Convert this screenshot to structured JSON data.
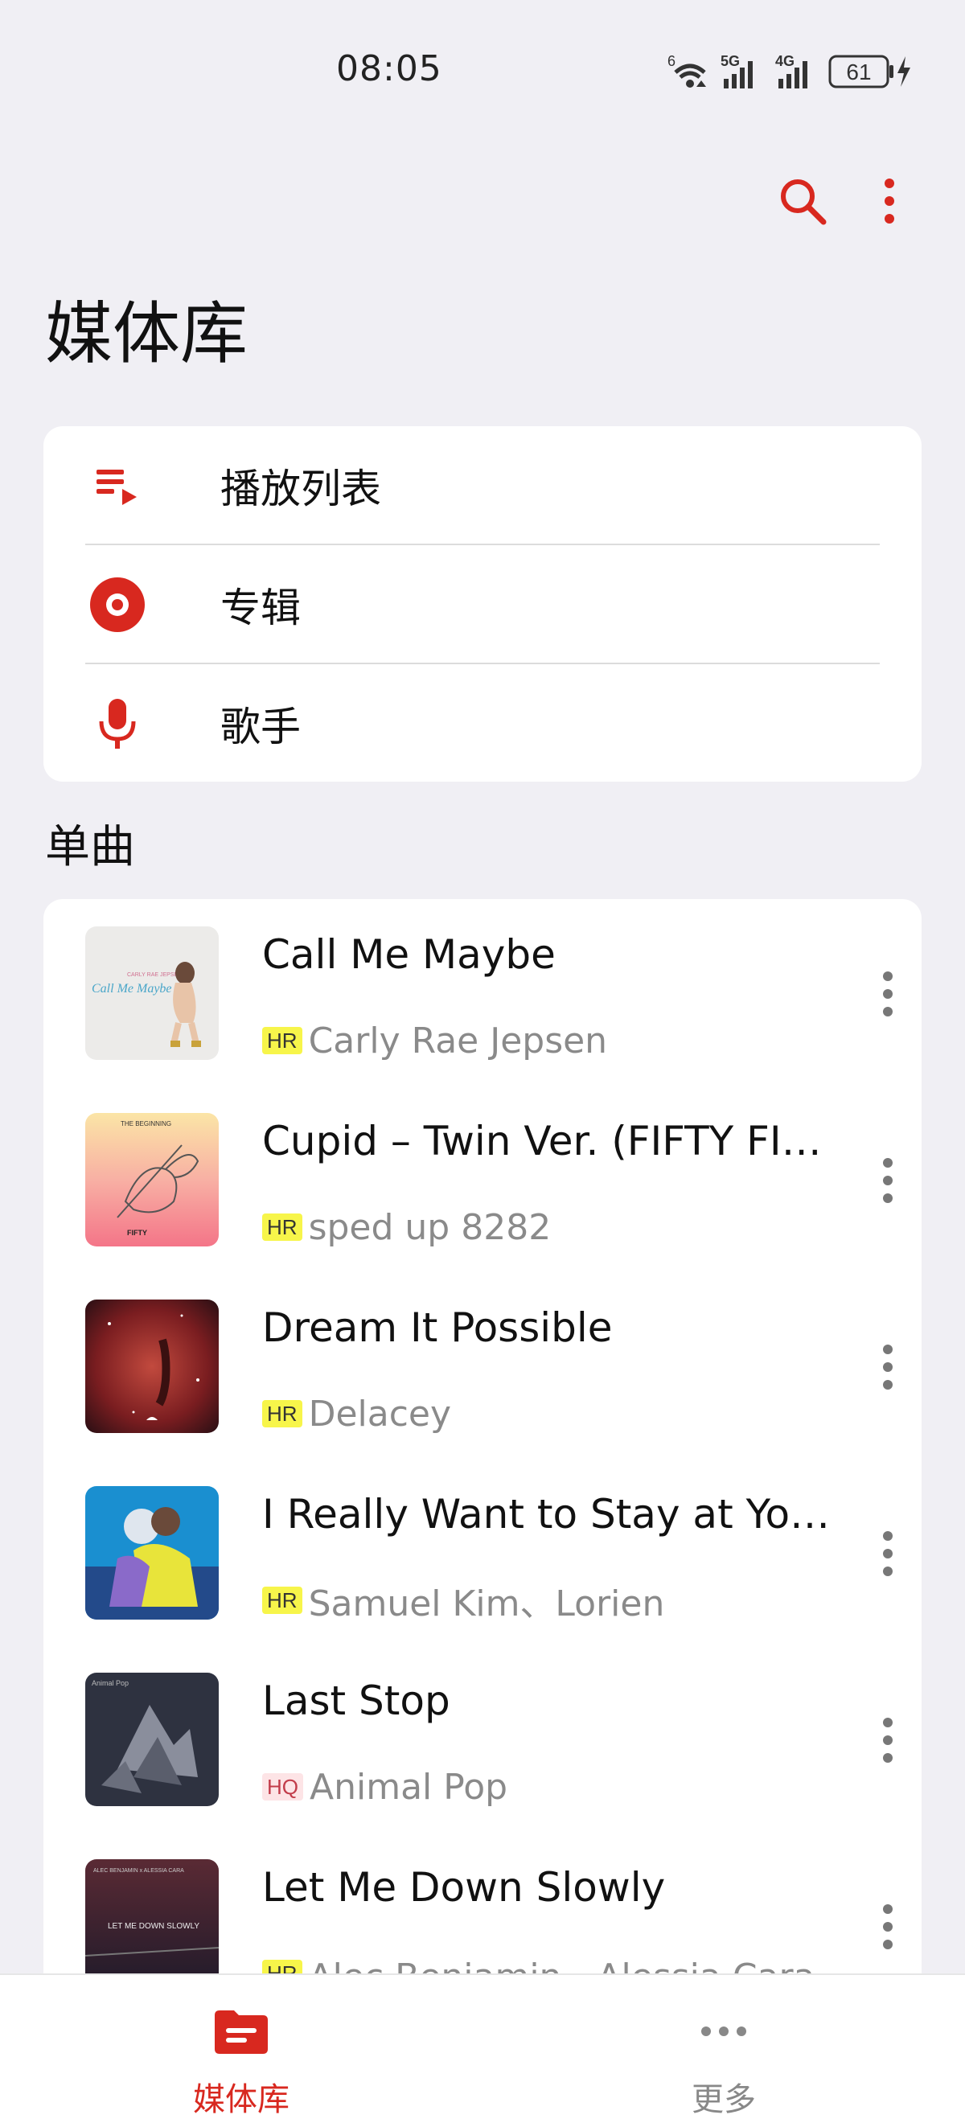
{
  "status_bar": {
    "time": "08:05",
    "wifi_label": "6",
    "signal_1_label": "5G",
    "signal_2_label": "4G",
    "battery": "61"
  },
  "header": {
    "title": "媒体库",
    "search_icon": "search-icon",
    "more_icon": "more-vertical-icon",
    "accent_color": "#d8281f"
  },
  "nav": {
    "items": [
      {
        "label": "播放列表",
        "icon": "playlist-icon"
      },
      {
        "label": "专辑",
        "icon": "album-icon"
      },
      {
        "label": "歌手",
        "icon": "microphone-icon"
      }
    ]
  },
  "songs": {
    "section_title": "单曲",
    "items": [
      {
        "title": "Call Me Maybe",
        "quality": "HR",
        "artist": "Carly Rae Jepsen"
      },
      {
        "title": "Cupid – Twin Ver. (FIFTY FI…",
        "quality": "HR",
        "artist": "sped up 8282"
      },
      {
        "title": "Dream It Possible",
        "quality": "HR",
        "artist": "Delacey"
      },
      {
        "title": "I Really Want to Stay at Yo…",
        "quality": "HR",
        "artist": "Samuel Kim、Lorien"
      },
      {
        "title": "Last Stop",
        "quality": "HQ",
        "artist": "Animal Pop"
      },
      {
        "title": "Let Me Down Slowly",
        "quality": "HR",
        "artist": "Alec Benjamin、Alessia Cara"
      }
    ]
  },
  "bottom_nav": {
    "library_label": "媒体库",
    "more_label": "更多"
  }
}
